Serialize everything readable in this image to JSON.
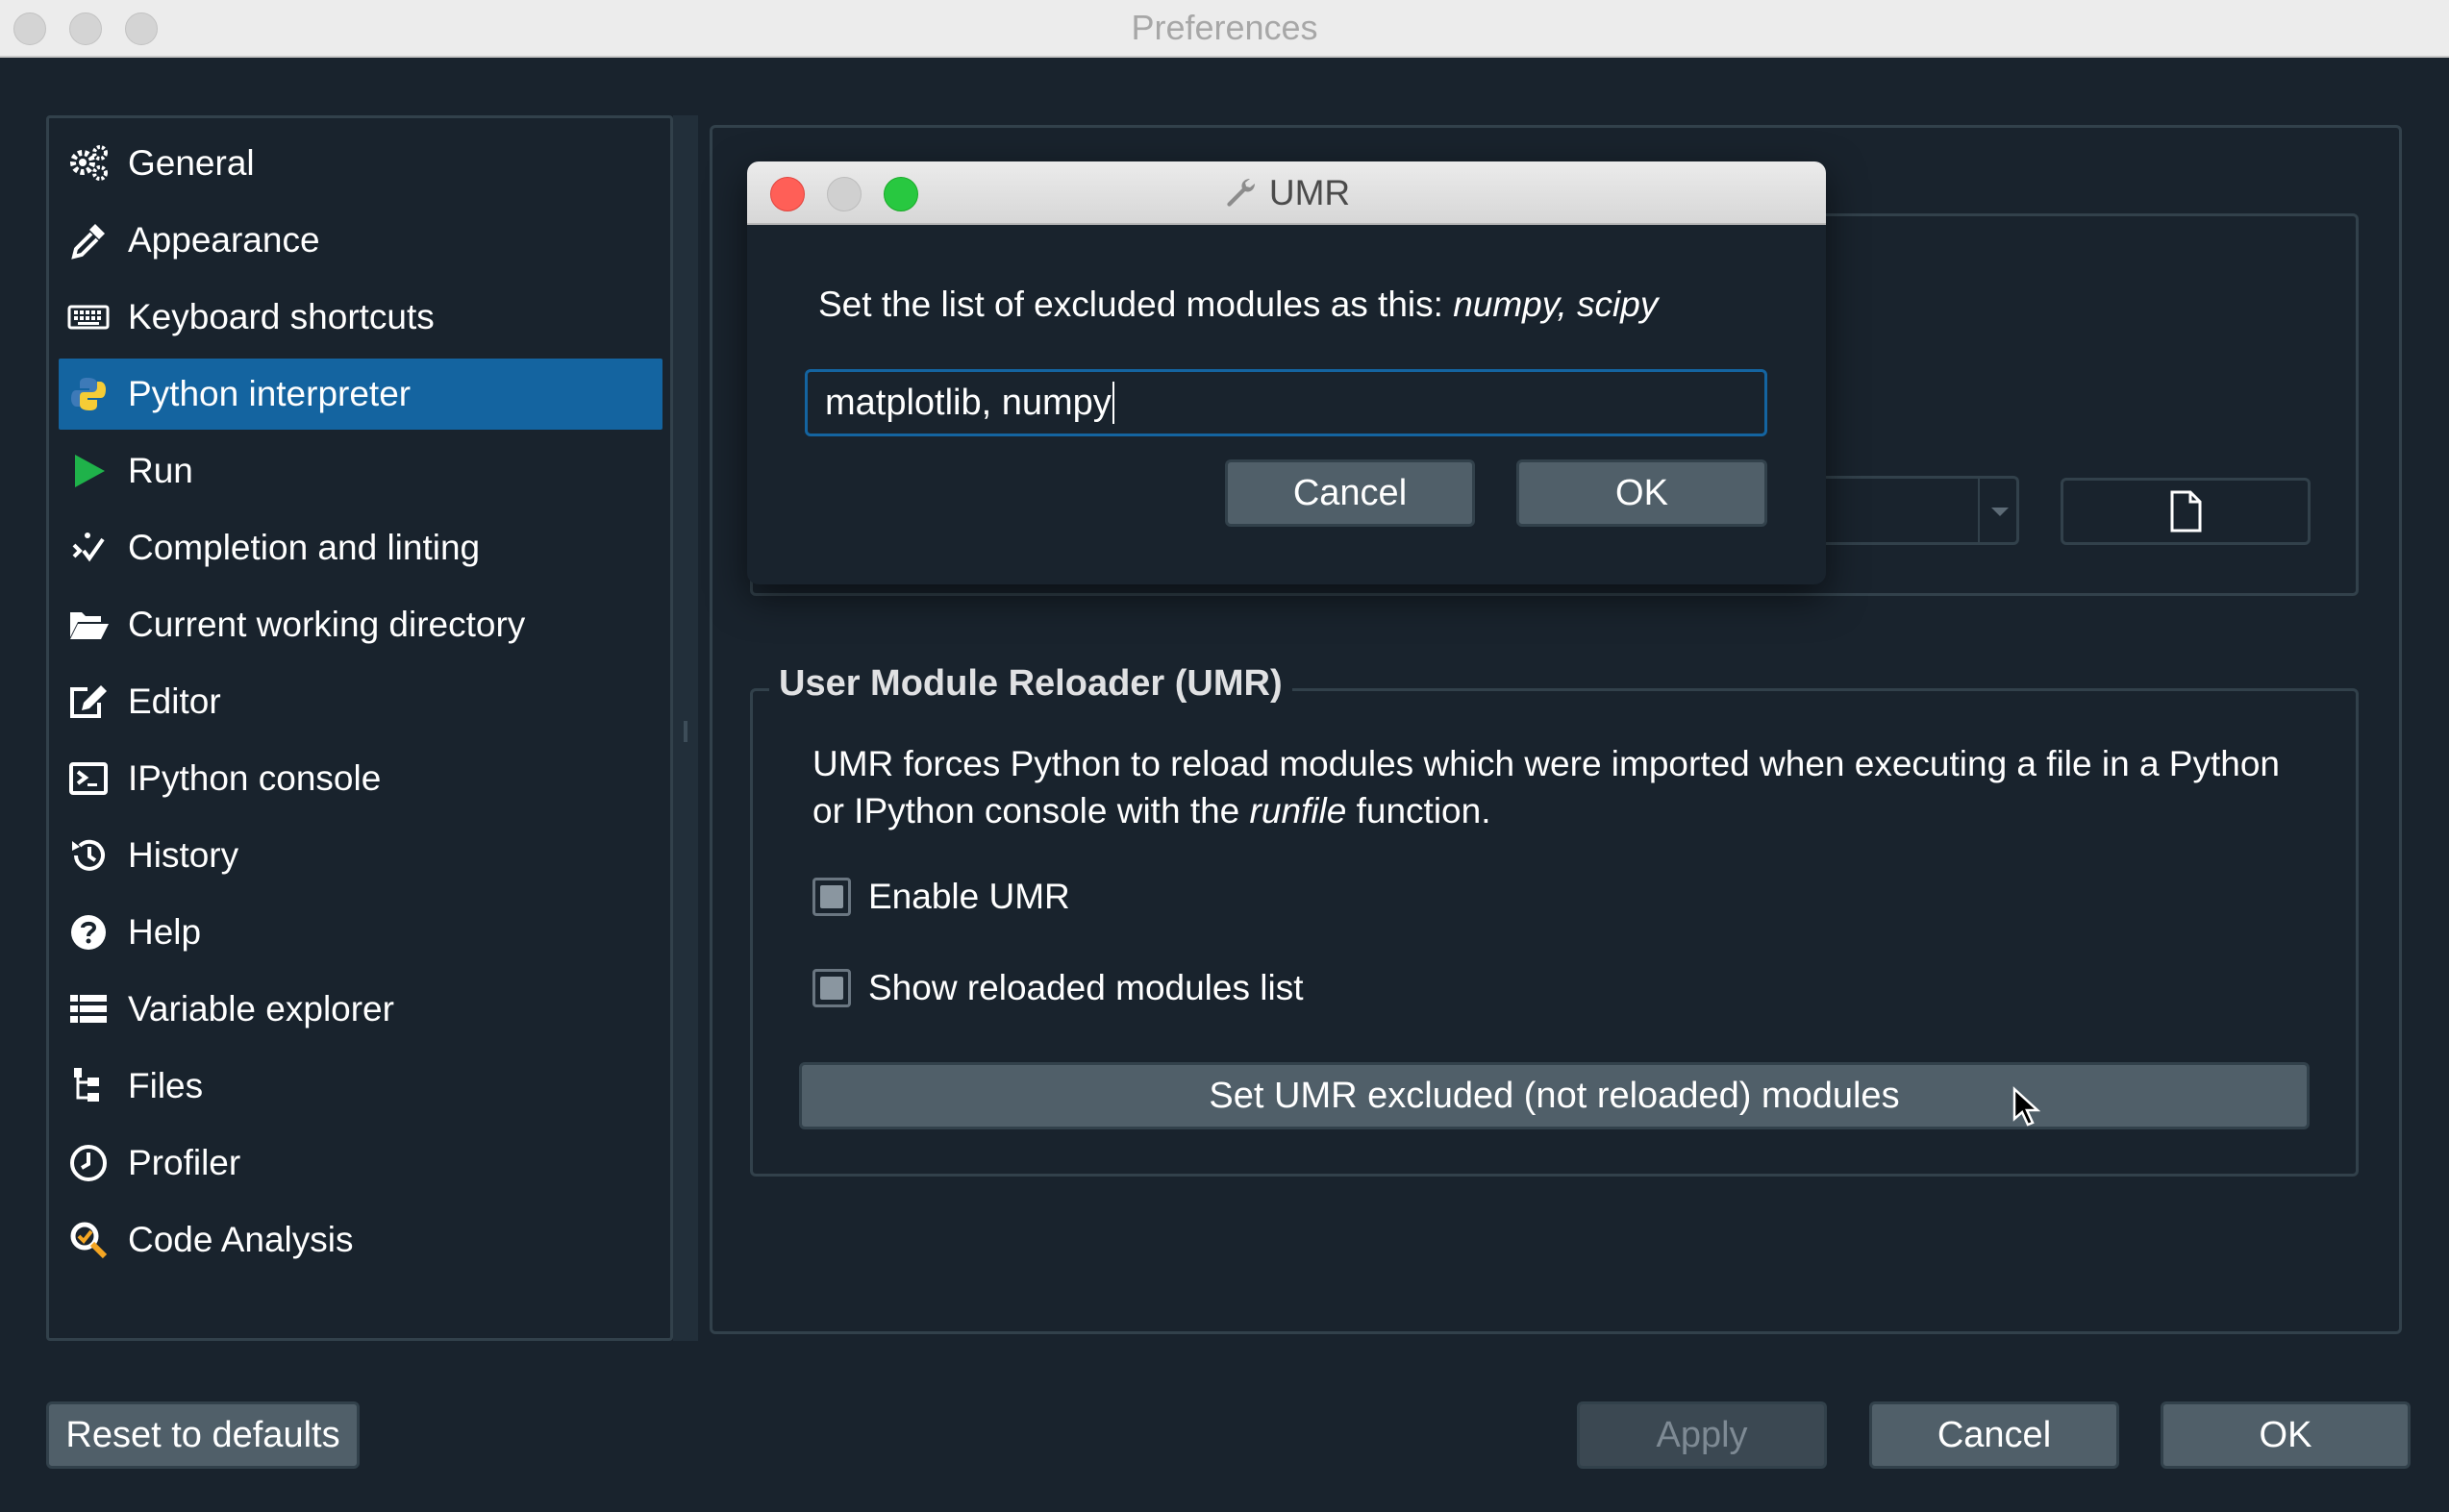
{
  "window": {
    "title": "Preferences"
  },
  "sidebar": {
    "items": [
      {
        "label": "General",
        "icon": "gears-icon"
      },
      {
        "label": "Appearance",
        "icon": "eyedropper-icon"
      },
      {
        "label": "Keyboard shortcuts",
        "icon": "keyboard-icon"
      },
      {
        "label": "Python interpreter",
        "icon": "python-icon"
      },
      {
        "label": "Run",
        "icon": "play-icon"
      },
      {
        "label": "Completion and linting",
        "icon": "completion-icon"
      },
      {
        "label": "Current working directory",
        "icon": "folder-open-icon"
      },
      {
        "label": "Editor",
        "icon": "edit-icon"
      },
      {
        "label": "IPython console",
        "icon": "terminal-icon"
      },
      {
        "label": "History",
        "icon": "history-icon"
      },
      {
        "label": "Help",
        "icon": "help-icon"
      },
      {
        "label": "Variable explorer",
        "icon": "table-list-icon"
      },
      {
        "label": "Files",
        "icon": "file-tree-icon"
      },
      {
        "label": "Profiler",
        "icon": "clock-icon"
      },
      {
        "label": "Code Analysis",
        "icon": "code-analysis-icon"
      }
    ],
    "selected": "Python interpreter"
  },
  "umr_group": {
    "title": "User Module Reloader (UMR)",
    "description_before": "UMR forces Python to reload modules which were imported when executing a file in a Python or IPython console with the ",
    "description_em": "runfile",
    "description_after": " function.",
    "enable_label": "Enable UMR",
    "show_list_label": "Show reloaded modules list",
    "set_excluded_button": "Set UMR excluded (not reloaded) modules"
  },
  "dialog": {
    "title": "UMR",
    "message_prefix": "Set the list of excluded modules as this: ",
    "message_em": "numpy, scipy",
    "input_value": "matplotlib, numpy",
    "cancel_label": "Cancel",
    "ok_label": "OK"
  },
  "footer": {
    "reset_label": "Reset to defaults",
    "apply_label": "Apply",
    "cancel_label": "Cancel",
    "ok_label": "OK"
  },
  "colors": {
    "background": "#19232d",
    "border": "#32414b",
    "accent": "#1464a0",
    "button": "#505f69",
    "close_red": "#ff5f57",
    "zoom_green": "#28c840"
  }
}
